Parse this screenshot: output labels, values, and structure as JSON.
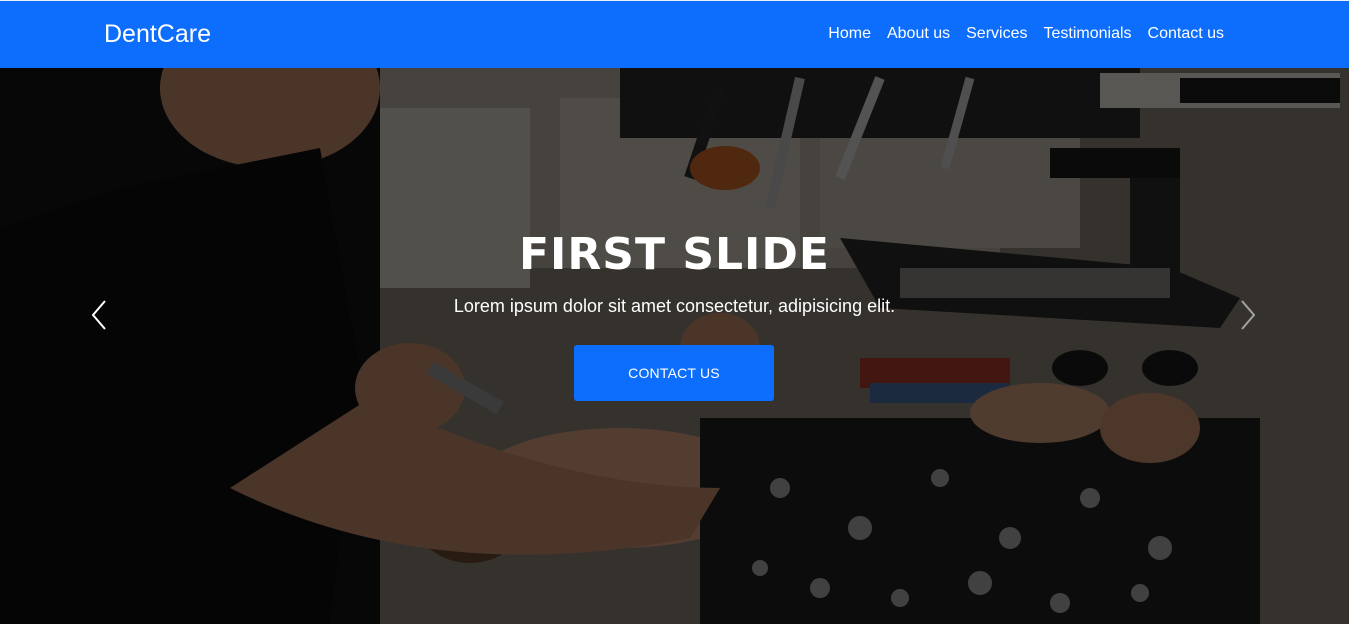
{
  "navbar": {
    "brand": "DentCare",
    "links": [
      {
        "label": "Home"
      },
      {
        "label": "About us"
      },
      {
        "label": "Services"
      },
      {
        "label": "Testimonials"
      },
      {
        "label": "Contact us"
      }
    ],
    "background_color": "#0d6efd"
  },
  "hero": {
    "title": "FIRST SLIDE",
    "subtitle": "Lorem ipsum dolor sit amet consectetur, adipisicing elit.",
    "button_label": "CONTACT US",
    "prev_icon": "chevron-left-icon",
    "next_icon": "chevron-right-icon",
    "background_image": "dentist-treating-patient-photo",
    "accent_color": "#0d6efd"
  }
}
